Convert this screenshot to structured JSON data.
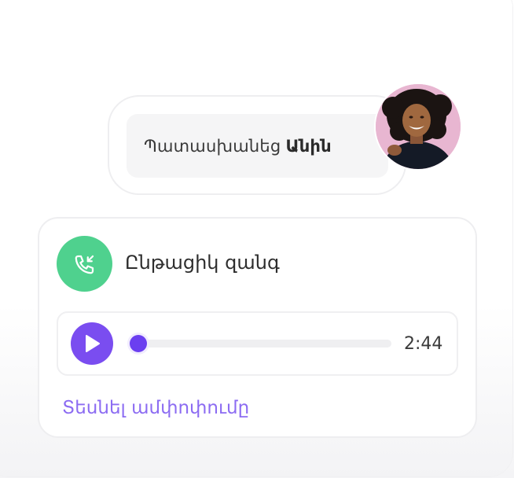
{
  "answer": {
    "prefix": "Պատասխանեց",
    "name": "Անին"
  },
  "call": {
    "title": "Ընթացիկ զանգ",
    "duration": "2:44",
    "progress": 0.03,
    "transcript_link": "Տեսնել ամփոփումը"
  },
  "colors": {
    "accent": "#7a4df0",
    "call_green": "#4fd18e",
    "link": "#8c6cf2"
  },
  "icons": {
    "call": "incoming-call-icon",
    "play": "play-icon"
  }
}
